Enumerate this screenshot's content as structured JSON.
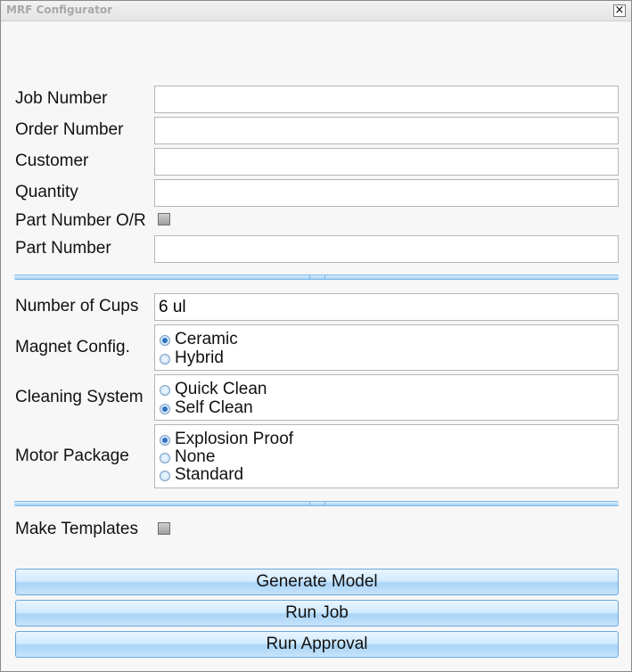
{
  "window": {
    "title": "MRF Configurator",
    "close_glyph": "×"
  },
  "job_info": {
    "job_number": {
      "label": "Job Number",
      "value": ""
    },
    "order_number": {
      "label": "Order Number",
      "value": ""
    },
    "customer": {
      "label": "Customer",
      "value": ""
    },
    "quantity": {
      "label": "Quantity",
      "value": ""
    },
    "part_number_override": {
      "label": "Part Number O/R",
      "checked": false
    },
    "part_number": {
      "label": "Part Number",
      "value": ""
    }
  },
  "config": {
    "number_of_cups": {
      "label": "Number of Cups",
      "value": "6 ul"
    },
    "magnet_config": {
      "label": "Magnet Config.",
      "options": [
        {
          "label": "Ceramic",
          "selected": true
        },
        {
          "label": "Hybrid",
          "selected": false
        }
      ]
    },
    "cleaning_system": {
      "label": "Cleaning System",
      "options": [
        {
          "label": "Quick Clean",
          "selected": false
        },
        {
          "label": "Self Clean",
          "selected": true
        }
      ]
    },
    "motor_package": {
      "label": "Motor Package",
      "options": [
        {
          "label": "Explosion Proof",
          "selected": true
        },
        {
          "label": "None",
          "selected": false
        },
        {
          "label": "Standard",
          "selected": false
        }
      ]
    }
  },
  "make_templates": {
    "label": "Make Templates",
    "checked": false
  },
  "actions": {
    "generate_model": "Generate Model",
    "run_job": "Run Job",
    "run_approval": "Run Approval"
  },
  "colors": {
    "accent": "#a9d4f7",
    "border": "#6aa7dc",
    "radio_dot": "#2f72c4"
  }
}
